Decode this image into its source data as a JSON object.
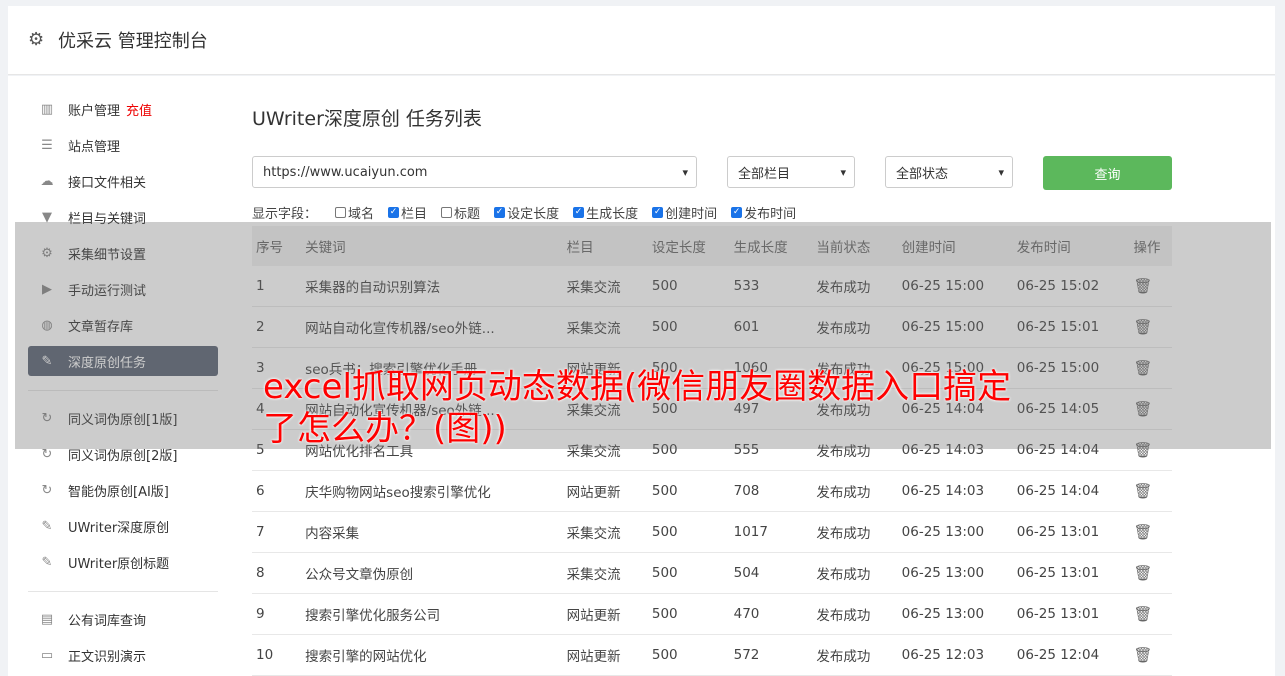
{
  "header": {
    "title": "优采云 管理控制台"
  },
  "sidebar": {
    "group1": [
      {
        "label": "账户管理",
        "tag": "充值",
        "icon": "bar-chart-icon"
      },
      {
        "label": "站点管理",
        "icon": "server-icon"
      },
      {
        "label": "接口文件相关",
        "icon": "cloud-upload-icon"
      },
      {
        "label": "栏目与关键词",
        "icon": "filter-icon"
      },
      {
        "label": "采集细节设置",
        "icon": "gears-icon"
      },
      {
        "label": "手动运行测试",
        "icon": "play-icon"
      },
      {
        "label": "文章暂存库",
        "icon": "database-icon"
      },
      {
        "label": "深度原创任务",
        "icon": "edit-icon",
        "active": true
      }
    ],
    "group2": [
      {
        "label": "同义词伪原创[1版]",
        "icon": "refresh-icon"
      },
      {
        "label": "同义词伪原创[2版]",
        "icon": "refresh-icon"
      },
      {
        "label": "智能伪原创[AI版]",
        "icon": "refresh-icon"
      },
      {
        "label": "UWriter深度原创",
        "icon": "edit-icon"
      },
      {
        "label": "UWriter原创标题",
        "icon": "edit-icon"
      }
    ],
    "group3": [
      {
        "label": "公有词库查询",
        "icon": "book-icon"
      },
      {
        "label": "正文识别演示",
        "icon": "monitor-icon"
      }
    ]
  },
  "content": {
    "title": "UWriter深度原创 任务列表",
    "site_select": "https://www.ucaiyun.com",
    "column_select": "全部栏目",
    "status_select": "全部状态",
    "query_button": "查询",
    "fields_label": "显示字段：",
    "fields": [
      {
        "label": "域名",
        "checked": false
      },
      {
        "label": "栏目",
        "checked": true
      },
      {
        "label": "标题",
        "checked": false
      },
      {
        "label": "设定长度",
        "checked": true
      },
      {
        "label": "生成长度",
        "checked": true
      },
      {
        "label": "创建时间",
        "checked": true
      },
      {
        "label": "发布时间",
        "checked": true
      }
    ],
    "columns": [
      "序号",
      "关键词",
      "栏目",
      "设定长度",
      "生成长度",
      "当前状态",
      "创建时间",
      "发布时间",
      "操作"
    ],
    "rows": [
      [
        "1",
        "采集器的自动识别算法",
        "采集交流",
        "500",
        "533",
        "发布成功",
        "06-25 15:00",
        "06-25 15:02"
      ],
      [
        "2",
        "网站自动化宣传机器/seo外链...",
        "采集交流",
        "500",
        "601",
        "发布成功",
        "06-25 15:00",
        "06-25 15:01"
      ],
      [
        "3",
        "seo兵书：搜索引擎优化手册",
        "网站更新",
        "500",
        "1060",
        "发布成功",
        "06-25 15:00",
        "06-25 15:00"
      ],
      [
        "4",
        "网站自动化宣传机器/seo外链...",
        "采集交流",
        "500",
        "497",
        "发布成功",
        "06-25 14:04",
        "06-25 14:05"
      ],
      [
        "5",
        "网站优化排名工具",
        "采集交流",
        "500",
        "555",
        "发布成功",
        "06-25 14:03",
        "06-25 14:04"
      ],
      [
        "6",
        "庆华购物网站seo搜索引擎优化",
        "网站更新",
        "500",
        "708",
        "发布成功",
        "06-25 14:03",
        "06-25 14:04"
      ],
      [
        "7",
        "内容采集",
        "采集交流",
        "500",
        "1017",
        "发布成功",
        "06-25 13:00",
        "06-25 13:01"
      ],
      [
        "8",
        "公众号文章伪原创",
        "采集交流",
        "500",
        "504",
        "发布成功",
        "06-25 13:00",
        "06-25 13:01"
      ],
      [
        "9",
        "搜索引擎优化服务公司",
        "网站更新",
        "500",
        "470",
        "发布成功",
        "06-25 13:00",
        "06-25 13:01"
      ],
      [
        "10",
        "搜索引擎的网站优化",
        "网站更新",
        "500",
        "572",
        "发布成功",
        "06-25 12:03",
        "06-25 12:04"
      ]
    ]
  },
  "overlay": {
    "headline": "excel抓取网页动态数据(微信朋友圈数据入口搞定了怎么办？(图))"
  },
  "colors": {
    "accent_green": "#5cb85c",
    "active_nav": "#5a6374",
    "status_ok": "#2e8b2e",
    "headline_red": "#ff0000"
  }
}
